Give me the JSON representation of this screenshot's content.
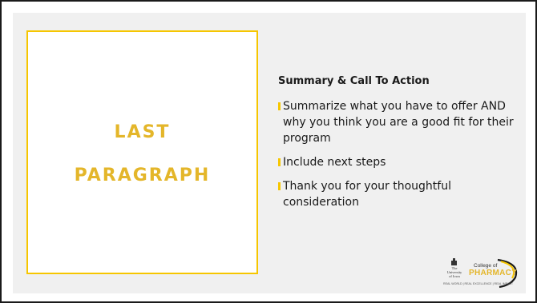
{
  "slide": {
    "title_lines": [
      "LAST",
      "PARAGRAPH"
    ],
    "subheading": "Summary & Call To Action",
    "bullets": [
      "Summarize what you have to offer AND why you think you are a good fit for their program",
      "Include next steps",
      "Thank you for your thoughtful consideration"
    ]
  },
  "logo": {
    "university_lines": [
      "The",
      "University",
      "of Iowa"
    ],
    "college": "College of",
    "pharmacy": "PHARMACY",
    "tagline": "REAL WORLD | REAL EXCELLENCE | REAL IMPACT"
  },
  "colors": {
    "accent_gold": "#f6c600",
    "title_gold": "#e4b62a",
    "panel_gray": "#f0f0f0",
    "text": "#1a1a1a"
  }
}
